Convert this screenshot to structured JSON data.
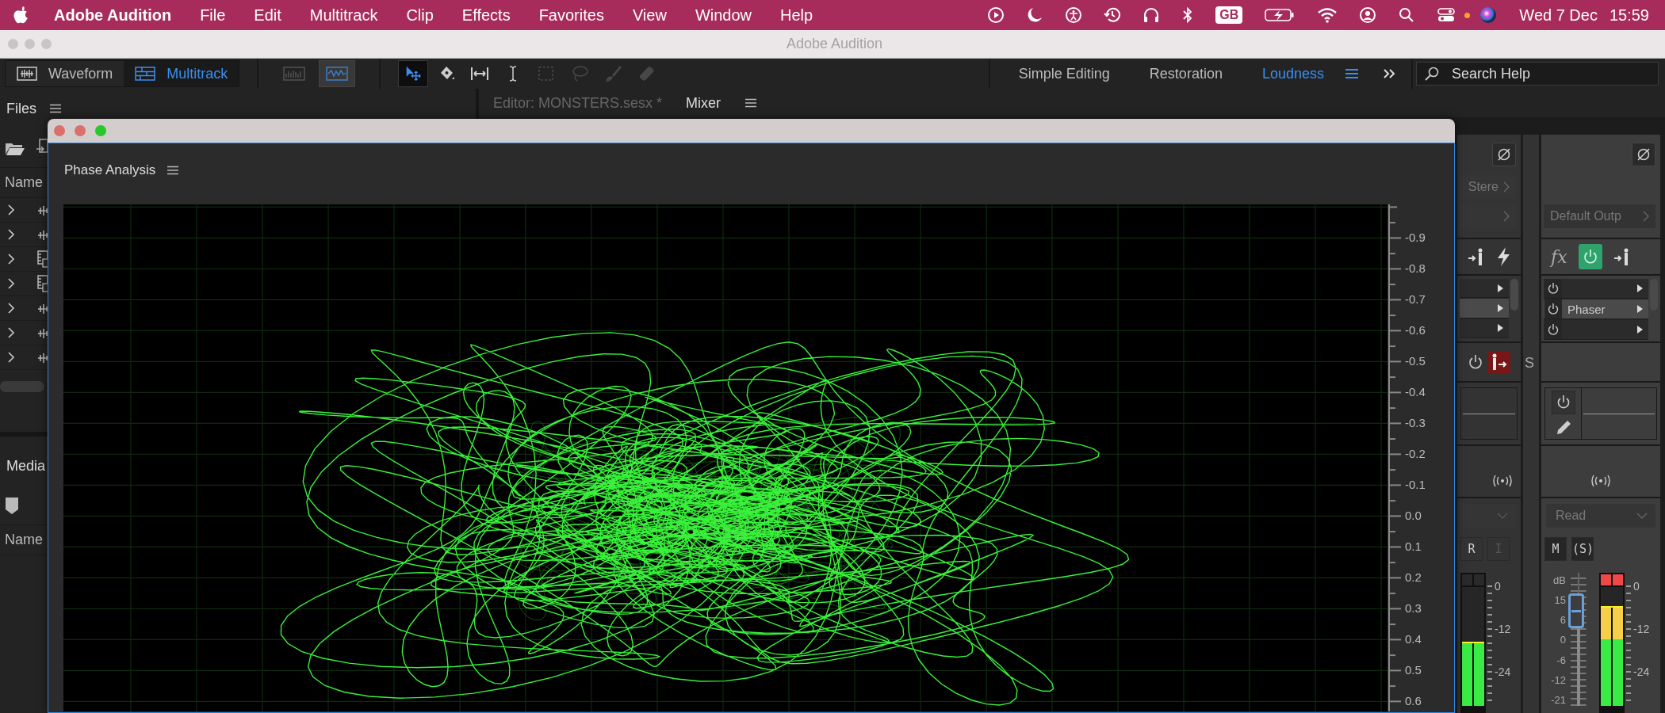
{
  "menu_bar": {
    "app_name": "Adobe Audition",
    "menus": [
      "File",
      "Edit",
      "Multitrack",
      "Clip",
      "Effects",
      "Favorites",
      "View",
      "Window",
      "Help"
    ],
    "keyboard_badge": "GB",
    "date": "Wed 7 Dec",
    "time": "15:59"
  },
  "window": {
    "title": "Adobe Audition"
  },
  "toolbar": {
    "modes": [
      {
        "label": "Waveform",
        "kind": "waveform",
        "selected": false
      },
      {
        "label": "Multitrack",
        "kind": "multitrack",
        "selected": true
      }
    ],
    "views": [
      {
        "kind": "spectral",
        "selected": false
      },
      {
        "kind": "waveform",
        "selected": true
      }
    ],
    "tools": [
      {
        "kind": "move",
        "selected": true,
        "disabled": false
      },
      {
        "kind": "razor",
        "selected": false,
        "disabled": false
      },
      {
        "kind": "slip",
        "selected": false,
        "disabled": false
      },
      {
        "kind": "time-selection",
        "selected": false,
        "disabled": false
      },
      {
        "kind": "marquee",
        "selected": false,
        "disabled": true
      },
      {
        "kind": "lasso",
        "selected": false,
        "disabled": true
      },
      {
        "kind": "brush",
        "selected": false,
        "disabled": true
      },
      {
        "kind": "heal",
        "selected": false,
        "disabled": true
      }
    ],
    "workspaces": [
      {
        "label": "Simple Editing",
        "selected": false
      },
      {
        "label": "Restoration",
        "selected": false
      },
      {
        "label": "Loudness",
        "selected": true
      }
    ],
    "search": {
      "placeholder": "Search Help"
    }
  },
  "files_panel": {
    "title": "Files",
    "column": "Name",
    "rows": [
      {
        "kind": "audio",
        "expanded": false
      },
      {
        "kind": "audio",
        "expanded": false
      },
      {
        "kind": "video",
        "expanded": false
      },
      {
        "kind": "video",
        "expanded": false
      },
      {
        "kind": "audio",
        "expanded": false
      },
      {
        "kind": "audio",
        "expanded": false
      },
      {
        "kind": "audio",
        "expanded": false
      }
    ]
  },
  "media_panel": {
    "title": "Media",
    "column": "Name"
  },
  "editor_tabs": [
    {
      "label": "Editor: MONSTERS.sesx *",
      "selected": false
    },
    {
      "label": "Mixer",
      "selected": true
    }
  ],
  "phase_window": {
    "title": "Phase Analysis",
    "y_axis_labels": [
      "-0.9",
      "-0.8",
      "-0.7",
      "-0.6",
      "-0.5",
      "-0.4",
      "-0.3",
      "-0.2",
      "-0.1",
      "0.0",
      "0.1",
      "0.2",
      "0.3",
      "0.4",
      "0.5",
      "0.6"
    ]
  },
  "mixer": {
    "strip_a": {
      "input": "Stere",
      "effects": [
        {
          "selected": false
        },
        {
          "selected": true
        },
        {
          "selected": false
        }
      ],
      "automation_buttons": [
        "R",
        "I"
      ],
      "meter": {
        "level": 0.54,
        "clip": false,
        "scale": [
          "0",
          "-12",
          "-24"
        ]
      }
    },
    "middle_strip": {
      "label": "S"
    },
    "strip_b": {
      "output": "Default Outp",
      "fx_label": "fx",
      "fx_power": true,
      "effects": [
        {
          "selected": false
        },
        {
          "name": "Phaser",
          "selected": true
        },
        {
          "selected": false
        }
      ],
      "automation": "Read",
      "buttons": [
        "M",
        "(S)"
      ],
      "fader": {
        "level": 0.73,
        "scale": [
          "dB",
          "15",
          "6",
          "0",
          "-6",
          "-12",
          "-21"
        ]
      },
      "meter": {
        "level": 0.84,
        "clip": true,
        "scale": [
          "0",
          "-12",
          "-24"
        ]
      }
    }
  }
}
